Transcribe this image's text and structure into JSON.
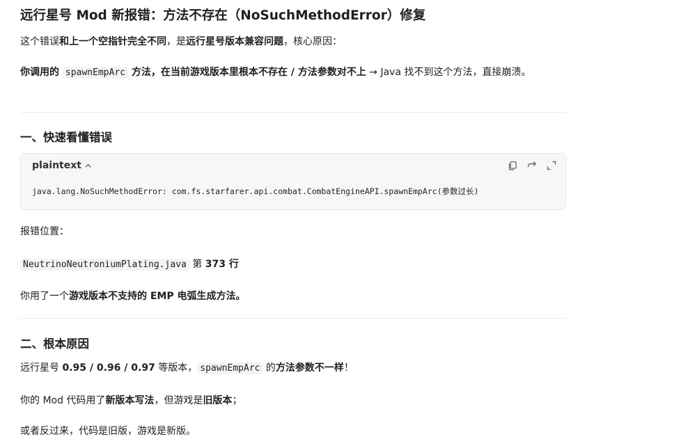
{
  "title": "远行星号 Mod 新报错：方法不存在（NoSuchMethodError）修复",
  "intro": {
    "line1_a": "这个错误",
    "line1_b": "和上一个空指针完全不同",
    "line1_c": "，是",
    "line1_d": "远行星号版本兼容问题",
    "line1_e": "，核心原因：",
    "line2_a": "你调用的 ",
    "line2_code": "spawnEmpArc",
    "line2_b": " 方法，在当前游戏版本里根本不存在 / 方法参数对不上",
    "line2_c": " → Java 找不到这个方法，直接崩溃。"
  },
  "section1": {
    "heading": "一、快速看懂错误",
    "code_lang": "plaintext",
    "code_text": "java.lang.NoSuchMethodError: com.fs.starfarer.api.combat.CombatEngineAPI.spawnEmpArc(参数过长)",
    "location_label": "报错位置：",
    "file_code": "NeutrinoNeutroniumPlating.java",
    "line_a": " 第 ",
    "line_b": "373 行",
    "used_a": "你用了一个",
    "used_b": "游戏版本不支持的 EMP 电弧生成方法。"
  },
  "section2": {
    "heading": "二、根本原因",
    "p1_a": "远行星号 ",
    "p1_b": "0.95 / 0.96 / 0.97",
    "p1_c": " 等版本，",
    "p1_code": "spawnEmpArc",
    "p1_d": " 的",
    "p1_e": "方法参数不一样",
    "p1_f": "！",
    "p2_a": "你的 Mod 代码用了",
    "p2_b": "新版本写法",
    "p2_c": "，但游戏是",
    "p2_d": "旧版本",
    "p2_e": "；",
    "p3": "或者反过来，代码是旧版，游戏是新版。"
  },
  "icons": [
    "chevron-up-icon",
    "copy-icon",
    "wrap-icon",
    "expand-icon"
  ]
}
